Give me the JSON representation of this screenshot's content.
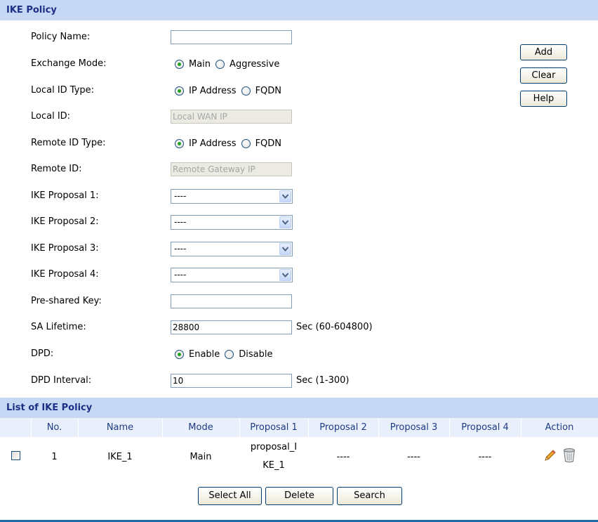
{
  "policy_section": {
    "title": "IKE Policy",
    "fields": {
      "policy_name": {
        "label": "Policy Name:",
        "value": ""
      },
      "exchange_mode": {
        "label": "Exchange Mode:",
        "options": [
          "Main",
          "Aggressive"
        ],
        "selected": "Main"
      },
      "local_id_type": {
        "label": "Local ID Type:",
        "options": [
          "IP Address",
          "FQDN"
        ],
        "selected": "IP Address"
      },
      "local_id": {
        "label": "Local ID:",
        "value": "Local WAN IP"
      },
      "remote_id_type": {
        "label": "Remote ID Type:",
        "options": [
          "IP Address",
          "FQDN"
        ],
        "selected": "IP Address"
      },
      "remote_id": {
        "label": "Remote ID:",
        "value": "Remote Gateway IP"
      },
      "ike_proposal_1": {
        "label": "IKE Proposal 1:",
        "value": "----"
      },
      "ike_proposal_2": {
        "label": "IKE Proposal 2:",
        "value": "----"
      },
      "ike_proposal_3": {
        "label": "IKE Proposal 3:",
        "value": "----"
      },
      "ike_proposal_4": {
        "label": "IKE Proposal 4:",
        "value": "----"
      },
      "pre_shared_key": {
        "label": "Pre-shared Key:",
        "value": ""
      },
      "sa_lifetime": {
        "label": "SA Lifetime:",
        "value": "28800",
        "unit": "Sec (60-604800)"
      },
      "dpd": {
        "label": "DPD:",
        "options": [
          "Enable",
          "Disable"
        ],
        "selected": "Enable"
      },
      "dpd_interval": {
        "label": "DPD Interval:",
        "value": "10",
        "unit": "Sec (1-300)"
      }
    },
    "buttons": {
      "add": "Add",
      "clear": "Clear",
      "help": "Help"
    }
  },
  "list_section": {
    "title": "List of IKE Policy",
    "columns": [
      "",
      "No.",
      "Name",
      "Mode",
      "Proposal 1",
      "Proposal 2",
      "Proposal 3",
      "Proposal 4",
      "Action"
    ],
    "rows": [
      {
        "no": "1",
        "name": "IKE_1",
        "mode": "Main",
        "proposal_1": "proposal_IKE_1",
        "proposal_2": "----",
        "proposal_3": "----",
        "proposal_4": "----",
        "checked": false
      }
    ],
    "buttons": {
      "select_all": "Select All",
      "delete": "Delete",
      "search": "Search"
    }
  },
  "colors": {
    "header_bg": "#c6d8f3",
    "header_text": "#1e2f86",
    "radio_dot": "#21a121",
    "footer_line": "#1f6aa7"
  },
  "icons": [
    "edit-pencil-icon",
    "delete-trash-icon",
    "select-arrow-icon"
  ]
}
